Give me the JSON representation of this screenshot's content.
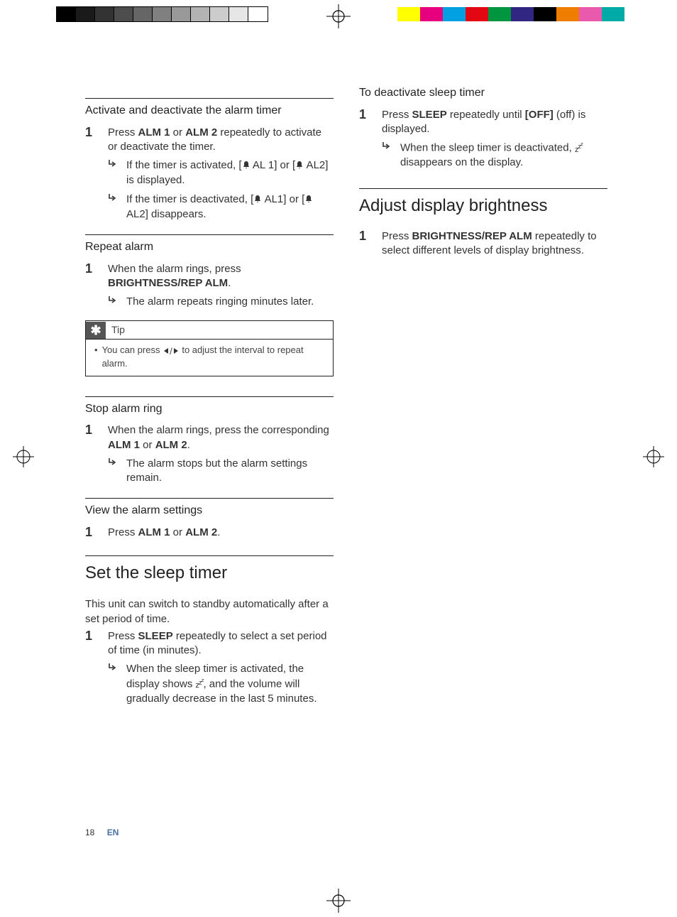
{
  "footer": {
    "page": "18",
    "lang": "EN"
  },
  "left": {
    "sec1": {
      "heading": "Activate and deactivate the alarm timer",
      "step1_a": "Press ",
      "step1_b": "ALM 1",
      "step1_c": " or ",
      "step1_d": "ALM 2",
      "step1_e": " repeatedly to activate or deactivate the timer.",
      "res1_a": "If the timer is activated, [",
      "res1_b": " AL 1] or [",
      "res1_c": " AL2] is displayed.",
      "res2_a": "If the timer is deactivated, [",
      "res2_b": " AL1] or [",
      "res2_c": " AL2] disappears."
    },
    "sec2": {
      "heading": "Repeat alarm",
      "step1_a": "When the alarm rings, press ",
      "step1_b": "BRIGHTNESS/REP ALM",
      "step1_c": ".",
      "res1": "The alarm repeats ringing minutes later."
    },
    "tip": {
      "title": "Tip",
      "body_a": "You can press ",
      "body_b": " to adjust the interval to repeat alarm."
    },
    "sec3": {
      "heading": "Stop alarm ring",
      "step1_a": "When the alarm rings, press the corresponding ",
      "step1_b": "ALM 1",
      "step1_c": " or ",
      "step1_d": "ALM 2",
      "step1_e": ".",
      "res1": "The alarm stops but the alarm settings remain."
    },
    "sec4": {
      "heading": "View the alarm settings",
      "step1_a": "Press ",
      "step1_b": "ALM 1",
      "step1_c": " or ",
      "step1_d": "ALM 2",
      "step1_e": "."
    },
    "sec5": {
      "heading": "Set the sleep timer",
      "intro": "This unit can switch to standby automatically after a set period of time.",
      "step1_a": "Press ",
      "step1_b": "SLEEP",
      "step1_c": " repeatedly to select a set period of time (in minutes).",
      "res1_a": "When the sleep timer is activated, the display shows ",
      "res1_b": ", and the volume will gradually decrease in the last 5 minutes."
    }
  },
  "right": {
    "sec1": {
      "heading": "To deactivate sleep timer",
      "step1_a": "Press ",
      "step1_b": "SLEEP",
      "step1_c": " repeatedly until ",
      "step1_d": "[OFF]",
      "step1_e": " (off) is displayed.",
      "res1_a": "When the sleep timer is deactivated, ",
      "res1_b": " disappears on the display."
    },
    "sec2": {
      "heading": "Adjust display brightness",
      "step1_a": "Press ",
      "step1_b": "BRIGHTNESS/REP ALM",
      "step1_c": " repeatedly to select different levels of display brightness."
    }
  }
}
